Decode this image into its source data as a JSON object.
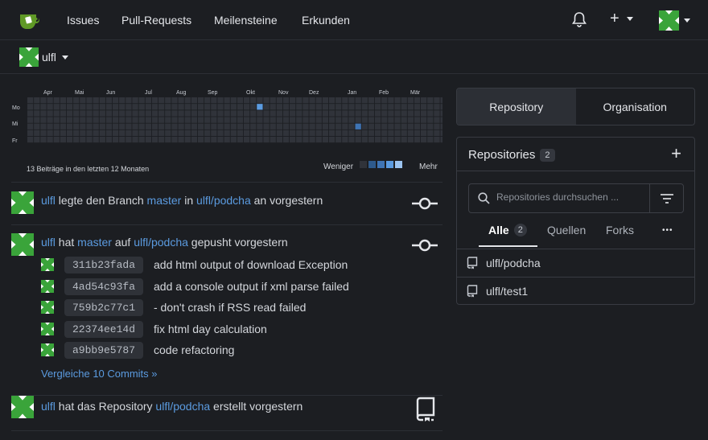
{
  "colors": {
    "accent": "#5b9be0",
    "brand": "#609926",
    "heat_empty": "#30333a",
    "heat_level1": "#2e5a8c",
    "heat_level2": "#3f74b4",
    "heat_level3": "#5b9be0",
    "heat_level4": "#9cc4f0"
  },
  "nav": {
    "items": [
      "Issues",
      "Pull-Requests",
      "Meilensteine",
      "Erkunden"
    ],
    "plus_label": "+"
  },
  "context": {
    "user": "ulfl"
  },
  "heatmap": {
    "months": [
      "Apr",
      "Mai",
      "Jun",
      "Jul",
      "Aug",
      "Sep",
      "Okt",
      "Nov",
      "Dez",
      "Jan",
      "Feb",
      "Mär"
    ],
    "weekdays": [
      "Mo",
      "Mi",
      "Fr"
    ],
    "summary": "13 Beiträge in den letzten 12 Monaten",
    "less_label": "Weniger",
    "more_label": "Mehr",
    "active_cells": [
      {
        "week": 35,
        "day": 1,
        "level": 3
      },
      {
        "week": 50,
        "day": 4,
        "level": 2
      }
    ]
  },
  "feed": [
    {
      "user": "ulfl",
      "text_before": " legte den Branch ",
      "branch": "master",
      "text_mid": " in ",
      "repo": "ulfl/podcha",
      "text_after": " an vorgestern",
      "icon": "git-commit-icon"
    },
    {
      "user": "ulfl",
      "text_before": " hat ",
      "branch": "master",
      "text_mid": " auf ",
      "repo": "ulfl/podcha",
      "text_after": " gepusht vorgestern",
      "icon": "git-commit-icon",
      "commits": [
        {
          "sha": "311b23fada",
          "message": "add html output of download Exception"
        },
        {
          "sha": "4ad54c93fa",
          "message": "add a console output if xml parse failed"
        },
        {
          "sha": "759b2c77c1",
          "message": "- don't crash if RSS read failed"
        },
        {
          "sha": "22374ee14d",
          "message": "fix html day calculation"
        },
        {
          "sha": "a9bb9e5787",
          "message": "code refactoring"
        }
      ],
      "compare_link": "Vergleiche 10 Commits »"
    },
    {
      "user": "ulfl",
      "text_before": " hat das Repository ",
      "repo": "ulfl/podcha",
      "text_after": " erstellt vorgestern",
      "icon": "repo-icon"
    }
  ],
  "right": {
    "tabs": [
      "Repository",
      "Organisation"
    ],
    "repos_title": "Repositories",
    "repos_count": "2",
    "add_label": "+",
    "search_placeholder": "Repositories durchsuchen ...",
    "filter_tabs": {
      "all": "Alle",
      "all_count": "2",
      "sources": "Quellen",
      "forks": "Forks",
      "more": "•••"
    },
    "repos": [
      "ulfl/podcha",
      "ulfl/test1"
    ]
  }
}
